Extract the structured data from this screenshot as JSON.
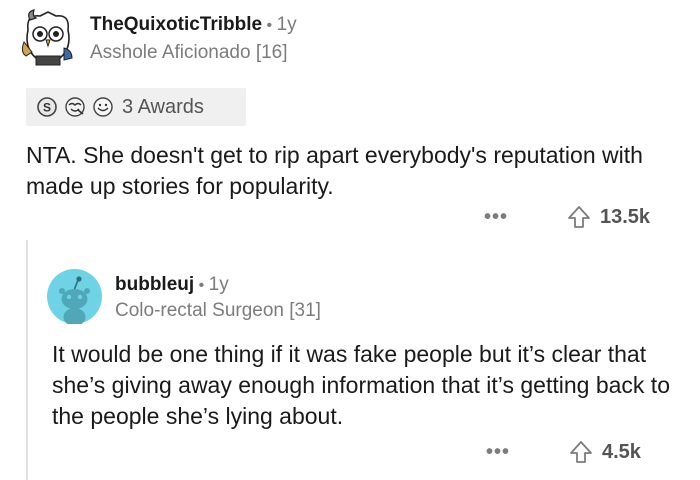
{
  "comment": {
    "username": "TheQuixoticTribble",
    "separator": "•",
    "age": "1y",
    "flair": "Asshole Aficionado [16]",
    "awards_label": "3 Awards",
    "award_icons": [
      "silver-award-icon",
      "wholesome-award-icon",
      "helpful-award-icon"
    ],
    "body": "NTA. She doesn't get to rip apart everybody's reputation with made up stories for popularity.",
    "more": "•••",
    "votes": "13.5k"
  },
  "reply": {
    "username": "bubbleuj",
    "separator": "•",
    "age": "1y",
    "flair": "Colo-rectal Surgeon [31]",
    "body": "It would be one thing if it was fake people but it’s clear that she’s giving away enough information that it’s getting back to the people she’s lying about.",
    "more": "•••",
    "votes": "4.5k"
  },
  "colors": {
    "text": "#1a1a1b",
    "meta": "#7c7c7c",
    "awards_bg": "#f0f0f0",
    "avatar2_bg": "#6fd3e6"
  }
}
